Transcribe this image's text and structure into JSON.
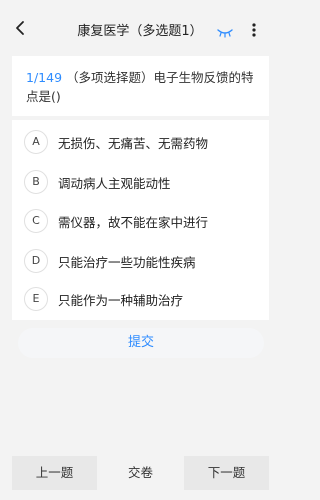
{
  "header": {
    "title": "康复医学（多选题1）",
    "back_icon": "chevron-left-icon",
    "eye_icon": "eye-closed-icon",
    "more_icon": "more-vertical-icon",
    "accent": "#2e8cff"
  },
  "question": {
    "number": "1/149",
    "text": "（多项选择题）电子生物反馈的特点是()"
  },
  "options": [
    {
      "letter": "A",
      "text": "无损伤、无痛苦、无需药物"
    },
    {
      "letter": "B",
      "text": "调动病人主观能动性"
    },
    {
      "letter": "C",
      "text": "需仪器，故不能在家中进行"
    },
    {
      "letter": "D",
      "text": "只能治疗一些功能性疾病"
    },
    {
      "letter": "E",
      "text": "只能作为一种辅助治疗"
    }
  ],
  "submit_label": "提交",
  "bottom": {
    "prev_label": "上一题",
    "hand_in_label": "交卷",
    "next_label": "下一题"
  }
}
